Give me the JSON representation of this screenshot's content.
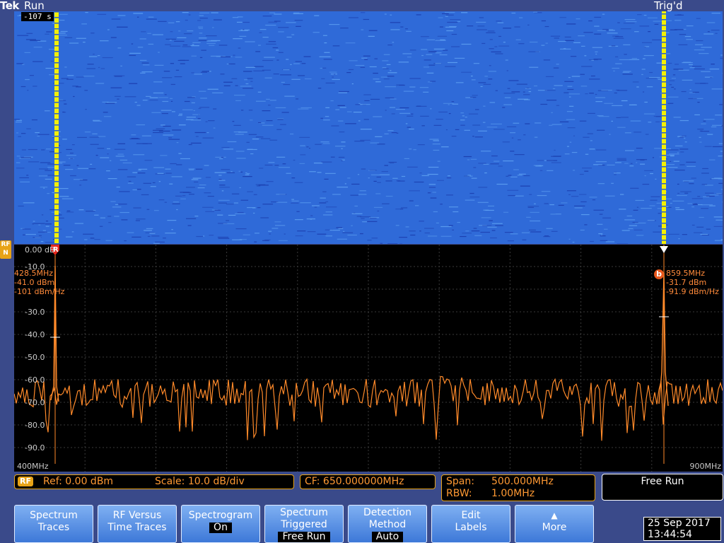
{
  "header": {
    "logo": "Tek",
    "run_state": "Run",
    "trigger_state": "Trig'd"
  },
  "colors": {
    "trace": "#ff8a2a",
    "waterfall_base": "#2f6ad8",
    "marker_line": "#f4f000",
    "status_accent": "#e8a317"
  },
  "spectrogram": {
    "time_label": "-107 s"
  },
  "spectrum": {
    "rf_channel_label": "RF N",
    "y_labels": [
      "0.00 dB",
      "-10.0",
      "-20.0",
      "-30.0",
      "-40.0",
      "-50.0",
      "-60.0",
      "-70.0",
      "-80.0",
      "-90.0"
    ],
    "start_freq": "400MHz",
    "stop_freq": "900MHz",
    "marker_r": {
      "symbol": "R",
      "freq": "428.5MHz",
      "power": "-41.0 dBm",
      "density": "-101 dBm/Hz"
    },
    "marker_b": {
      "symbol": "b",
      "freq": "859.5MHz",
      "power": "-31.7 dBm",
      "density": "-91.9 dBm/Hz"
    }
  },
  "status": {
    "rf_badge": "RF",
    "ref": "Ref: 0.00 dBm",
    "scale": "Scale: 10.0 dB/div",
    "cf": "CF:  650.000000MHz",
    "span_label": "Span:",
    "span_value": "500.000MHz",
    "rbw_label": "RBW:",
    "rbw_value": "1.00MHz",
    "mode": "Free Run"
  },
  "softkeys": [
    {
      "line1": "Spectrum",
      "line2": "Traces",
      "sub": ""
    },
    {
      "line1": "RF Versus",
      "line2": "Time Traces",
      "sub": ""
    },
    {
      "line1": "Spectrogram",
      "line2": "",
      "sub": "On"
    },
    {
      "line1": "Spectrum",
      "line2": "Triggered",
      "sub": "Free Run"
    },
    {
      "line1": "Detection",
      "line2": "Method",
      "sub": "Auto"
    },
    {
      "line1": "Edit",
      "line2": "Labels",
      "sub": ""
    },
    {
      "line1": "▲",
      "line2": "More",
      "sub": ""
    }
  ],
  "datetime": {
    "date": "25 Sep  2017",
    "time": "13:44:54"
  }
}
